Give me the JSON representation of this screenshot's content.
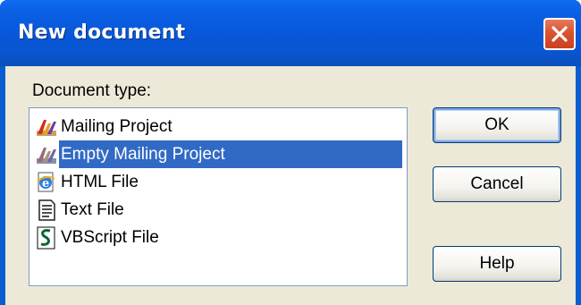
{
  "window": {
    "title": "New document"
  },
  "form": {
    "document_type_label": "Document type:"
  },
  "document_types": [
    {
      "label": "Mailing Project",
      "icon": "mailing-project-icon",
      "selected": false
    },
    {
      "label": "Empty Mailing Project",
      "icon": "mailing-project-icon",
      "selected": true
    },
    {
      "label": "HTML File",
      "icon": "html-file-icon",
      "selected": false
    },
    {
      "label": "Text File",
      "icon": "text-file-icon",
      "selected": false
    },
    {
      "label": "VBScript File",
      "icon": "vbscript-file-icon",
      "selected": false
    }
  ],
  "buttons": {
    "ok": "OK",
    "cancel": "Cancel",
    "help": "Help"
  },
  "colors": {
    "titlebar": "#0a5fe3",
    "selection": "#316ac5",
    "dialog_background": "#ece9d8",
    "close_button": "#d9542f"
  }
}
